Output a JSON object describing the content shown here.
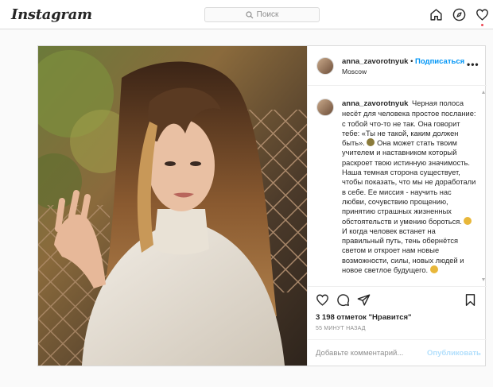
{
  "header": {
    "logo": "Instagram",
    "search_placeholder": "Поиск",
    "icons": [
      "home-icon",
      "explore-icon",
      "activity-heart-icon"
    ],
    "has_notification": true
  },
  "post": {
    "username": "anna_zavorotnyuk",
    "separator": "•",
    "follow_label": "Подписаться",
    "location": "Moscow",
    "more_label": "•••",
    "caption_username": "anna_zavorotnyuk",
    "caption_part1": "Черная полоса несёт для человека простое послание: с тобой что-то не так. Она говорит тебе: «Ты не такой, каким должен быть».",
    "caption_part2": "Она может стать твоим учителем и наставником который раскроет твою истинную значимость. Наша темная сторона существует, чтобы показать, что мы не доработали в себе. Ее миссия - научить нас любви, сочувствию прощению, принятию страшных жизненных обстоятельств и умению бороться.",
    "caption_part3": "И когда человек встанет на правильный путь, тень обернётся светом и откроет нам новые возможности, силы, новых людей и новое светлое будущего.",
    "emoji_color": "#e8b73a",
    "likes": "3 198 отметок \"Нравится\"",
    "time_ago": "55 МИНУТ НАЗАД",
    "comment_placeholder": "Добавьте комментарий...",
    "publish_label": "Опубликовать"
  },
  "colors": {
    "accent": "#0095f6",
    "publish_disabled": "#b2dffc",
    "border": "#dbdbdb",
    "notification": "#ed4956"
  }
}
